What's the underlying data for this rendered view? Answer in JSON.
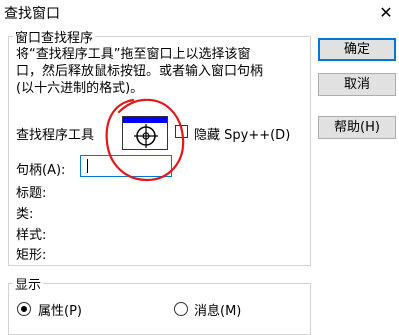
{
  "window": {
    "title": "查找窗口",
    "close_glyph": "✕"
  },
  "finder_group": {
    "legend": "窗口查找程序",
    "description_lines": [
      "将“查找程序工具”拖至窗口上以选择该窗",
      "口，然后释放鼠标按钮。或者输入窗口句柄",
      "(以十六进制的格式)。"
    ],
    "finder_tool_label": "查找程序工具",
    "finder_tool_icon": "crosshair-target-icon",
    "hide_spy_label": "隐藏 Spy++(D)",
    "hide_spy_checked": false,
    "handle_label": "句柄(A):",
    "handle_value": "",
    "title_label": "标题:",
    "class_label": "类:",
    "style_label": "样式:",
    "rect_label": "矩形:"
  },
  "buttons": {
    "ok": "确定",
    "cancel": "取消",
    "help": "帮助(H)"
  },
  "display_group": {
    "legend": "显示",
    "properties_label": "属性(P)",
    "messages_label": "消息(M)",
    "selected": "properties"
  },
  "annotation": {
    "color": "#e0191a"
  }
}
